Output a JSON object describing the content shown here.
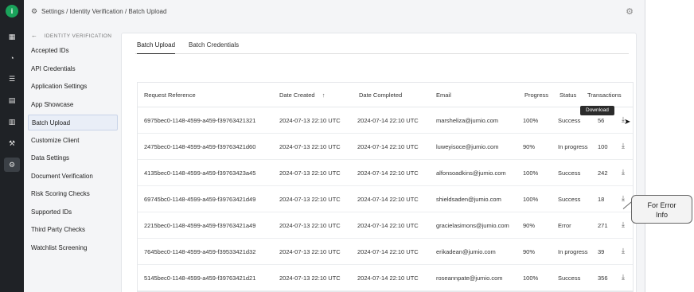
{
  "rail": {
    "logo": "i",
    "items": [
      {
        "icon": "dashboard-icon",
        "glyph": "▦"
      },
      {
        "icon": "chart-icon",
        "glyph": "◔"
      },
      {
        "icon": "list-icon",
        "glyph": "☰"
      },
      {
        "icon": "document-icon",
        "glyph": "▤"
      },
      {
        "icon": "report-icon",
        "glyph": "▥"
      },
      {
        "icon": "hammer-icon",
        "glyph": "⚒"
      },
      {
        "icon": "settings-icon",
        "glyph": "⚙"
      }
    ]
  },
  "breadcrumb": {
    "icon_glyph": "⚙",
    "text": "Settings / Identity Verification / Batch Upload",
    "right_icon_glyph": "⚙"
  },
  "sidenav": {
    "back_glyph": "←",
    "heading": "IDENTITY VERIFICATION",
    "items": [
      "Accepted IDs",
      "API Credentials",
      "Application Settings",
      "App Showcase",
      "Batch Upload",
      "Customize Client",
      "Data Settings",
      "Document Verification",
      "Risk Scoring Checks",
      "Supported IDs",
      "Third Party Checks",
      "Watchlist Screening"
    ],
    "selected": "Batch Upload"
  },
  "tabs": [
    "Batch Upload",
    "Batch Credentials"
  ],
  "table": {
    "columns": [
      "Request Reference",
      "Date Created",
      "Date Completed",
      "Email",
      "Progress",
      "Status",
      "Transactions"
    ],
    "sort_glyph": "↑",
    "download_glyph": "⤓",
    "rows": [
      [
        "6975bec0-1148-4599-a459-f39763421321",
        "2024-07-13 22:10 UTC",
        "2024-07-14 22:10 UTC",
        "marsheliza@jumio.com",
        "100%",
        "Success",
        "56"
      ],
      [
        "2475bec0-1148-4599-a459-f39763421d60",
        "2024-07-13 22:10 UTC",
        "2024-07-14 22:10 UTC",
        "luweyisoce@jumio.com",
        "90%",
        "In progress",
        "100"
      ],
      [
        "4135bec0-1148-4599-a459-f39763423a45",
        "2024-07-13 22:10 UTC",
        "2024-07-14 22:10 UTC",
        "alfonsoadkins@jumio.com",
        "100%",
        "Success",
        "242"
      ],
      [
        "69745bc0-1148-4599-a459-f39763421d49",
        "2024-07-13 22:10 UTC",
        "2024-07-14 22:10 UTC",
        "shieldsaden@jumio.com",
        "100%",
        "Success",
        "18"
      ],
      [
        "2215bec0-1148-4599-a459-f39763421a49",
        "2024-07-13 22:10 UTC",
        "2024-07-14 22:10 UTC",
        "gracielasimons@jumio.com",
        "90%",
        "Error",
        "271"
      ],
      [
        "7645bec0-1148-4599-a459-f39533421d32",
        "2024-07-13 22:10 UTC",
        "2024-07-14 22:10 UTC",
        "erikadean@jumio.com",
        "90%",
        "In progress",
        "39"
      ],
      [
        "5145bec0-1148-4599-a459-f39763421d21",
        "2024-07-13 22:10 UTC",
        "2024-07-14 22:10 UTC",
        "roseannpate@jumio.com",
        "100%",
        "Success",
        "356"
      ]
    ]
  },
  "tooltip": "Download",
  "callout": {
    "line1": "For Error",
    "line2": "Info"
  }
}
